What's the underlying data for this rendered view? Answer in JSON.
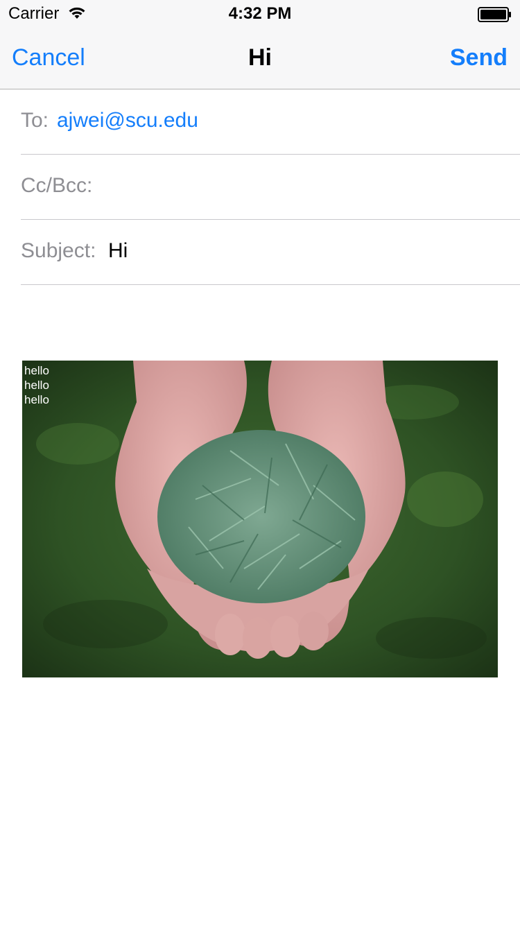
{
  "status": {
    "carrier": "Carrier",
    "time": "4:32 PM",
    "wifi_icon": "wifi-icon",
    "battery_icon": "battery-icon"
  },
  "nav": {
    "cancel_label": "Cancel",
    "title": "Hi",
    "send_label": "Send"
  },
  "colors": {
    "accent": "#147efb",
    "label_gray": "#8e8e93",
    "bar_bg": "#f7f7f8"
  },
  "compose": {
    "to_label": "To:",
    "to_value": "ajwei@scu.edu",
    "ccbcc_label": "Cc/Bcc:",
    "ccbcc_value": "",
    "subject_label": "Subject:",
    "subject_value": "Hi"
  },
  "body": {
    "image_overlay_lines": [
      "hello",
      "hello",
      "hello"
    ]
  }
}
